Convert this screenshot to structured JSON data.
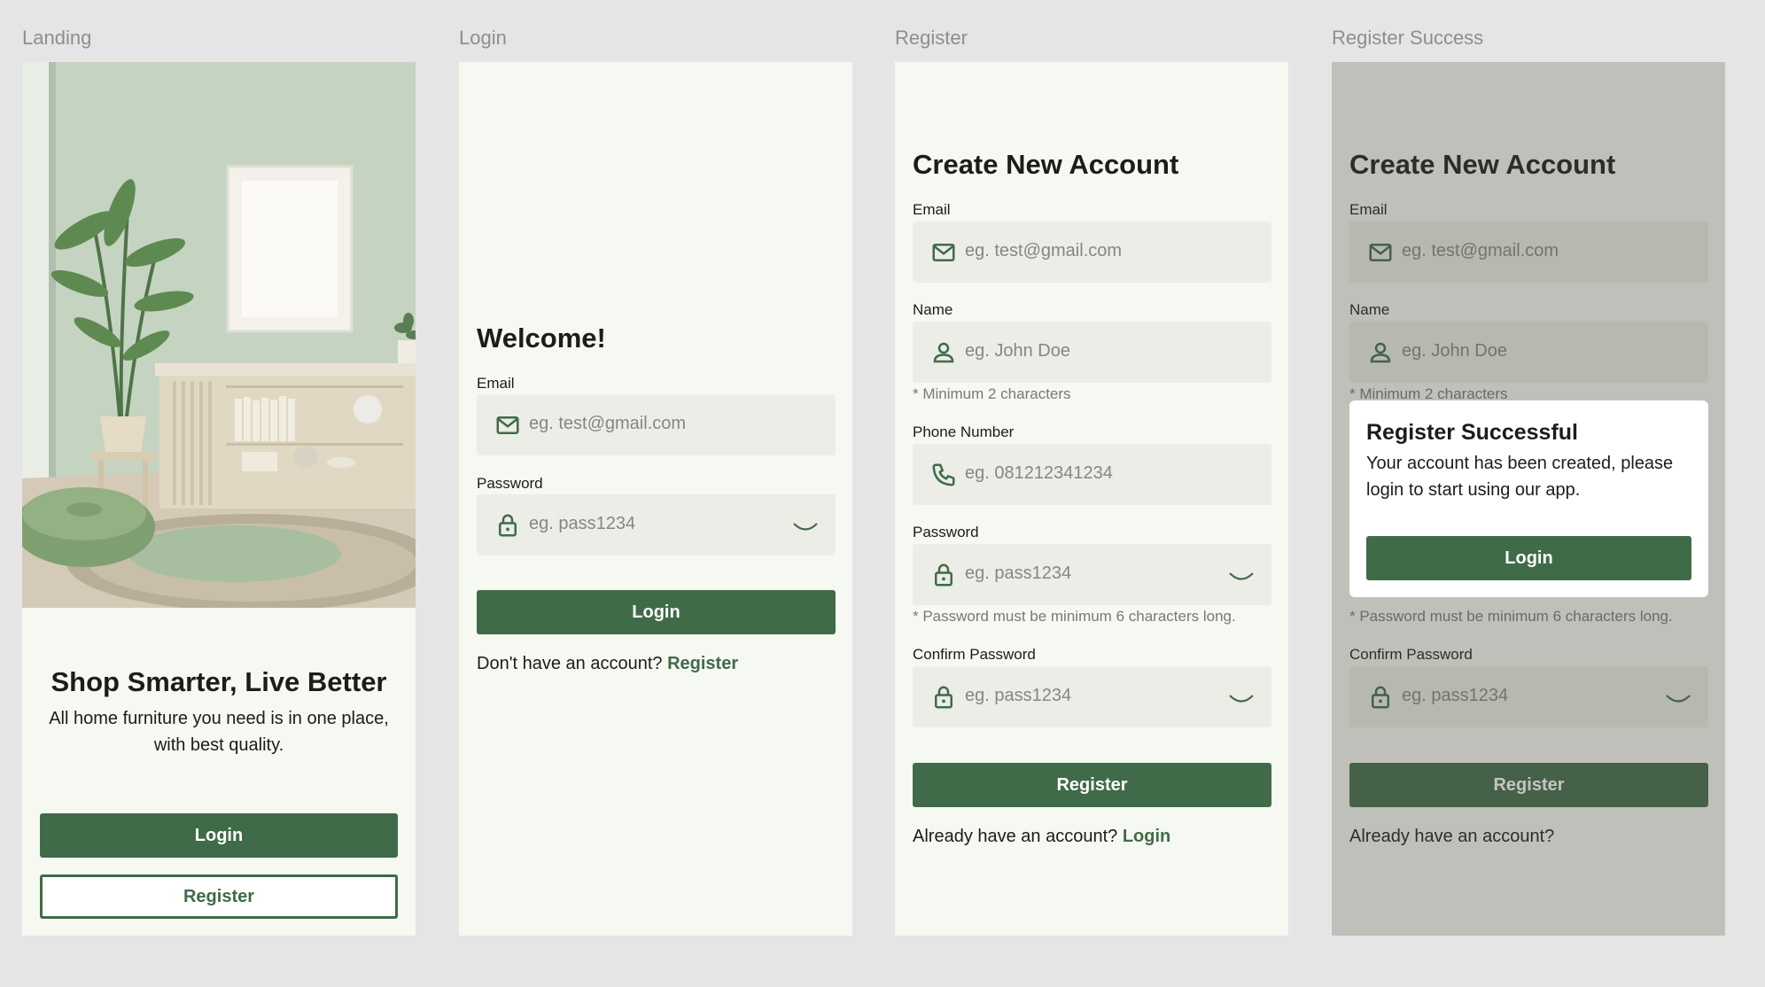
{
  "frames": {
    "landing": "Landing",
    "login": "Login",
    "register": "Register",
    "success": "Register Success"
  },
  "landing": {
    "title": "Shop Smarter, Live Better",
    "subtitle": "All home furniture you need is in one place, with best quality.",
    "login_button": "Login",
    "register_button": "Register"
  },
  "login": {
    "title": "Welcome!",
    "email_label": "Email",
    "email_placeholder": "eg. test@gmail.com",
    "password_label": "Password",
    "password_placeholder": "eg. pass1234",
    "login_button": "Login",
    "footer_text": "Don't have an account?",
    "footer_link": "Register"
  },
  "register": {
    "title": "Create New Account",
    "email_label": "Email",
    "email_placeholder": "eg. test@gmail.com",
    "name_label": "Name",
    "name_placeholder": "eg. John Doe",
    "name_hint": "* Minimum 2 characters",
    "phone_label": "Phone Number",
    "phone_placeholder": "eg. 081212341234",
    "password_label": "Password",
    "password_placeholder": "eg. pass1234",
    "password_hint": "* Password must be minimum 6 characters long.",
    "confirm_label": "Confirm Password",
    "confirm_placeholder": "eg. pass1234",
    "register_button": "Register",
    "footer_text": "Already have an account?",
    "footer_link": "Login"
  },
  "success": {
    "title": "Create New Account",
    "email_label": "Email",
    "email_placeholder": "eg. test@gmail.com",
    "name_label": "Name",
    "name_placeholder": "eg. John Doe",
    "name_hint": "* Minimum 2 characters",
    "password_hint": "* Password must be minimum 6 characters long.",
    "confirm_label": "Confirm Password",
    "confirm_placeholder": "eg. pass1234",
    "register_button": "Register",
    "footer_text": "Already have an account?",
    "modal": {
      "title": "Register Successful",
      "body": "Your account has been created, please login to start using our app.",
      "login_button": "Login"
    }
  },
  "colors": {
    "background": "#e5e5e5",
    "screen": "#f6f8f2",
    "field": "#ebede6",
    "primary": "#406b48",
    "text": "#1c1c1c",
    "muted": "#858782"
  },
  "icons": [
    "mail-icon",
    "lock-icon",
    "eye-closed-icon",
    "user-icon",
    "phone-icon"
  ]
}
